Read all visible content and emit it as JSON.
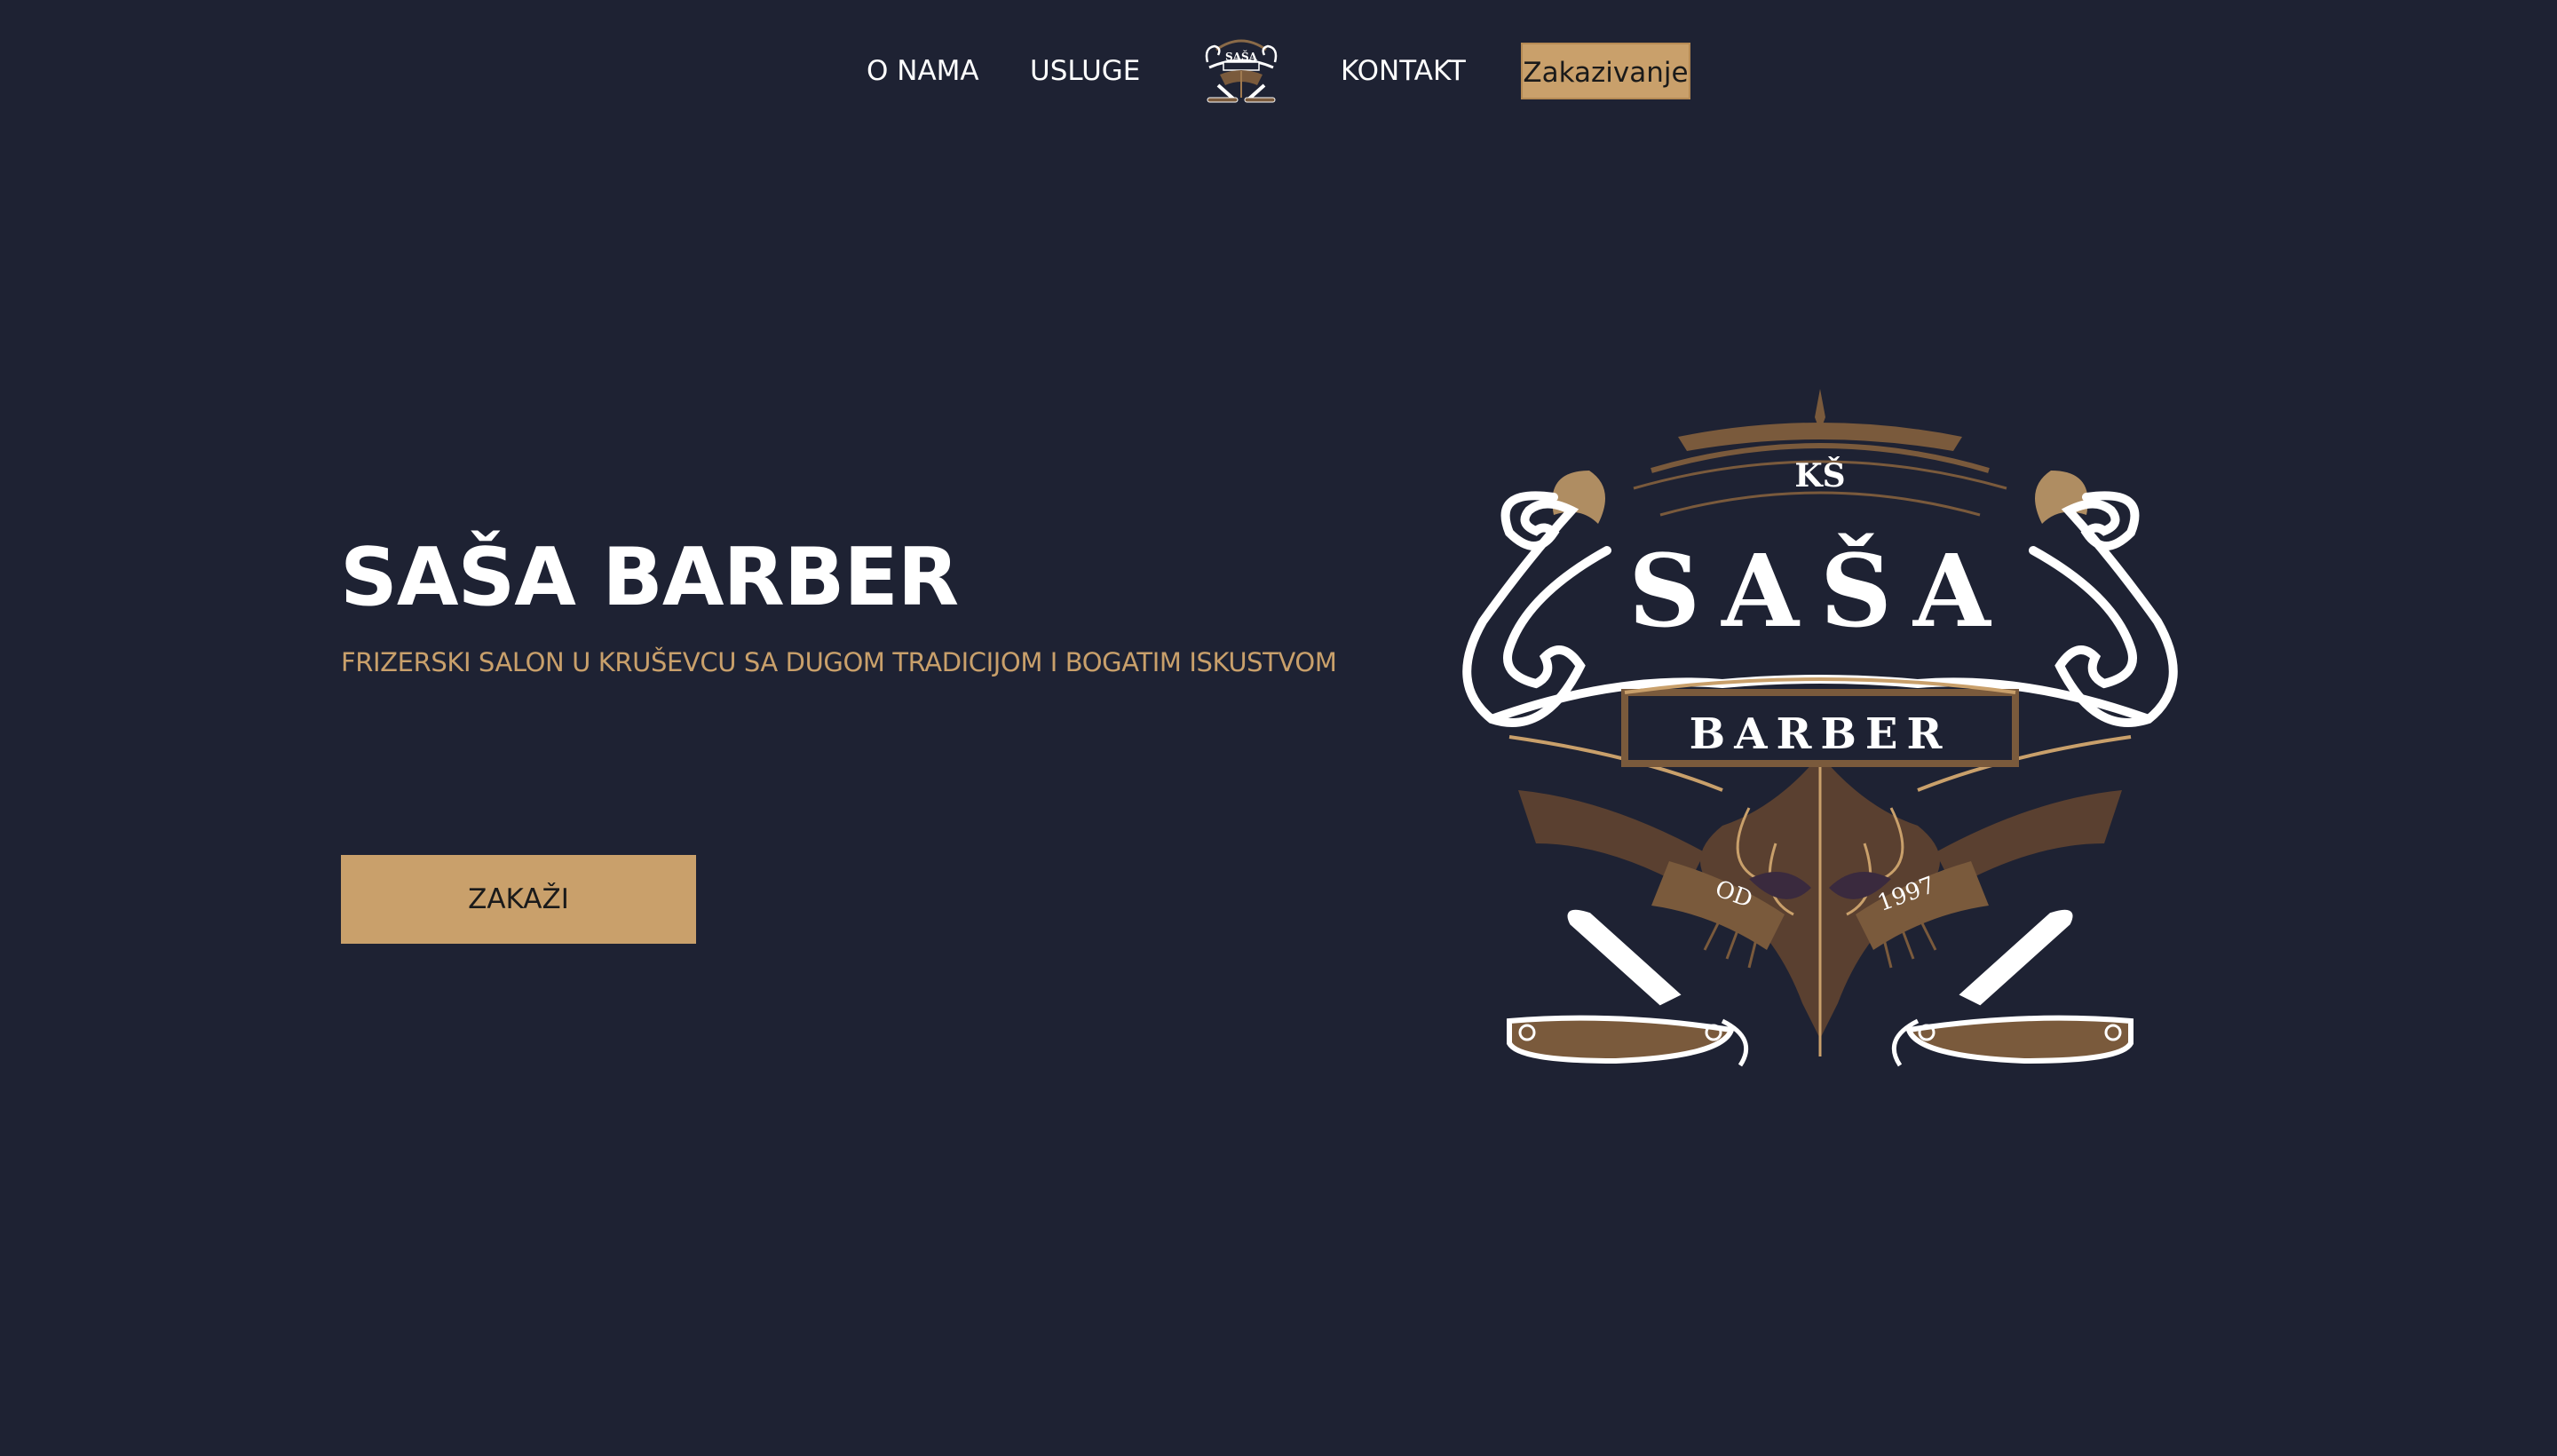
{
  "nav": {
    "items": [
      {
        "label": "O NAMA"
      },
      {
        "label": "USLUGE"
      },
      {
        "label": "KONTAKT"
      }
    ],
    "cta_label": "Zakazivanje"
  },
  "hero": {
    "title": "SAŠA BARBER",
    "subtitle": "FRIZERSKI SALON U KRUŠEVCU SA DUGOM TRADICIJOM I BOGATIM ISKUSTVOM",
    "button_label": "ZAKAŽI"
  },
  "emblem": {
    "monogram": "KŠ",
    "name": "SAŠA",
    "word": "BARBER",
    "since_left": "OD",
    "since_right": "1997"
  },
  "colors": {
    "background": "#1e2233",
    "accent": "#c9a06b",
    "text": "#ffffff",
    "emblem_brown": "#7a5a3c"
  },
  "icons": {
    "nav_logo": "barber-emblem-logo-icon",
    "hero_emblem": "barber-emblem-logo"
  }
}
